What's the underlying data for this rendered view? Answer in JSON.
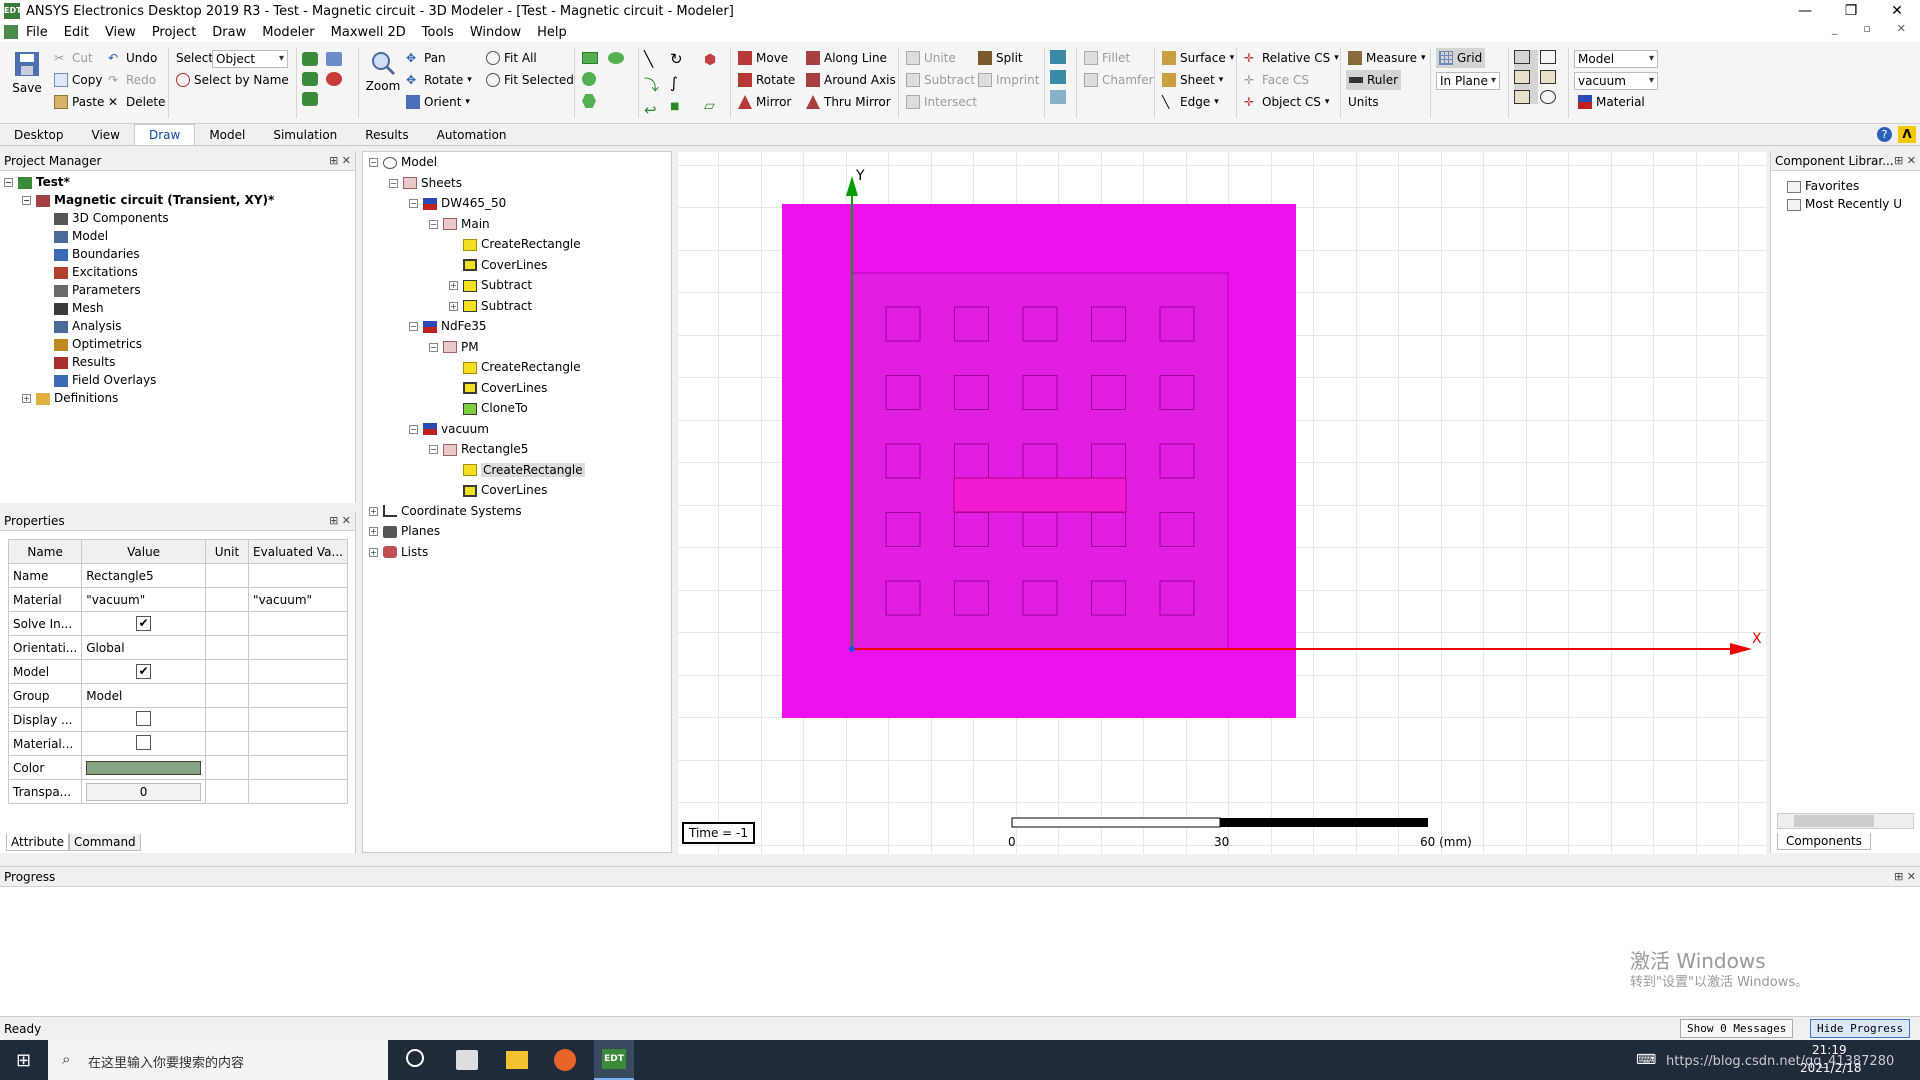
{
  "window": {
    "title": "ANSYS Electronics Desktop 2019 R3 - Test - Magnetic circuit - 3D Modeler - [Test - Magnetic circuit - Modeler]",
    "app_icon": "EDT"
  },
  "menu": [
    "File",
    "Edit",
    "View",
    "Project",
    "Draw",
    "Modeler",
    "Maxwell 2D",
    "Tools",
    "Window",
    "Help"
  ],
  "ribbon": {
    "save": "Save",
    "cut": "Cut",
    "copy": "Copy",
    "paste": "Paste",
    "undo": "Undo",
    "redo": "Redo",
    "delete": "Delete",
    "select_label": "Select:",
    "select_value": "Object",
    "select_by_name": "Select by Name",
    "zoom": "Zoom",
    "pan": "Pan",
    "rotate": "Rotate",
    "orient": "Orient",
    "fit_all": "Fit All",
    "fit_selected": "Fit Selected",
    "move": "Move",
    "rotate2": "Rotate",
    "mirror": "Mirror",
    "along_line": "Along Line",
    "around_axis": "Around Axis",
    "thru_mirror": "Thru Mirror",
    "unite": "Unite",
    "subtract": "Subtract",
    "intersect": "Intersect",
    "split": "Split",
    "imprint": "Imprint",
    "fillet": "Fillet",
    "chamfer": "Chamfer",
    "surface": "Surface",
    "sheet": "Sheet",
    "edge": "Edge",
    "relative_cs": "Relative CS",
    "face_cs": "Face CS",
    "object_cs": "Object CS",
    "measure": "Measure",
    "ruler": "Ruler",
    "units": "Units",
    "grid": "Grid",
    "in_plane": "In Plane",
    "model_dd": "Model",
    "material_dd": "vacuum",
    "material": "Material"
  },
  "tabs": [
    "Desktop",
    "View",
    "Draw",
    "Model",
    "Simulation",
    "Results",
    "Automation"
  ],
  "active_tab": "Draw",
  "project_manager": {
    "title": "Project Manager",
    "items": [
      {
        "label": "Test*",
        "level": 0,
        "exp": "-"
      },
      {
        "label": "Magnetic circuit (Transient, XY)*",
        "level": 1,
        "exp": "-"
      },
      {
        "label": "3D Components",
        "level": 2,
        "exp": ""
      },
      {
        "label": "Model",
        "level": 2,
        "exp": ""
      },
      {
        "label": "Boundaries",
        "level": 2,
        "exp": ""
      },
      {
        "label": "Excitations",
        "level": 2,
        "exp": ""
      },
      {
        "label": "Parameters",
        "level": 2,
        "exp": ""
      },
      {
        "label": "Mesh",
        "level": 2,
        "exp": ""
      },
      {
        "label": "Analysis",
        "level": 2,
        "exp": ""
      },
      {
        "label": "Optimetrics",
        "level": 2,
        "exp": ""
      },
      {
        "label": "Results",
        "level": 2,
        "exp": ""
      },
      {
        "label": "Field Overlays",
        "level": 2,
        "exp": ""
      },
      {
        "label": "Definitions",
        "level": 1,
        "exp": "+"
      }
    ]
  },
  "properties": {
    "title": "Properties",
    "headers": [
      "Name",
      "Value",
      "Unit",
      "Evaluated Va..."
    ],
    "rows": [
      {
        "name": "Name",
        "value": "Rectangle5",
        "unit": "",
        "eval": "",
        "type": "text"
      },
      {
        "name": "Material",
        "value": "\"vacuum\"",
        "unit": "",
        "eval": "\"vacuum\"",
        "type": "text"
      },
      {
        "name": "Solve In...",
        "value": "✔",
        "unit": "",
        "eval": "",
        "type": "check"
      },
      {
        "name": "Orientati...",
        "value": "Global",
        "unit": "",
        "eval": "",
        "type": "text"
      },
      {
        "name": "Model",
        "value": "✔",
        "unit": "",
        "eval": "",
        "type": "check"
      },
      {
        "name": "Group",
        "value": "Model",
        "unit": "",
        "eval": "",
        "type": "text"
      },
      {
        "name": "Display ...",
        "value": "",
        "unit": "",
        "eval": "",
        "type": "check"
      },
      {
        "name": "Material...",
        "value": "",
        "unit": "",
        "eval": "",
        "type": "check"
      },
      {
        "name": "Color",
        "value": "",
        "unit": "",
        "eval": "",
        "type": "color"
      },
      {
        "name": "Transpa...",
        "value": "0",
        "unit": "",
        "eval": "",
        "type": "field"
      }
    ],
    "color_swatch": "#84a484",
    "bottom_tabs": [
      "Attribute",
      "Command"
    ]
  },
  "model_tree": [
    {
      "label": "Model",
      "level": 0,
      "exp": "-",
      "icon": "model"
    },
    {
      "label": "Sheets",
      "level": 1,
      "exp": "-",
      "icon": "sheet"
    },
    {
      "label": "DW465_50",
      "level": 2,
      "exp": "-",
      "icon": "mat"
    },
    {
      "label": "Main",
      "level": 3,
      "exp": "-",
      "icon": "sheet"
    },
    {
      "label": "CreateRectangle",
      "level": 4,
      "exp": "",
      "icon": "rect"
    },
    {
      "label": "CoverLines",
      "level": 4,
      "exp": "",
      "icon": "cover"
    },
    {
      "label": "Subtract",
      "level": 4,
      "exp": "+",
      "icon": "op"
    },
    {
      "label": "Subtract",
      "level": 4,
      "exp": "+",
      "icon": "op"
    },
    {
      "label": "NdFe35",
      "level": 2,
      "exp": "-",
      "icon": "mat"
    },
    {
      "label": "PM",
      "level": 3,
      "exp": "-",
      "icon": "sheet"
    },
    {
      "label": "CreateRectangle",
      "level": 4,
      "exp": "",
      "icon": "rect"
    },
    {
      "label": "CoverLines",
      "level": 4,
      "exp": "",
      "icon": "cover"
    },
    {
      "label": "CloneTo",
      "level": 4,
      "exp": "",
      "icon": "clone"
    },
    {
      "label": "vacuum",
      "level": 2,
      "exp": "-",
      "icon": "mat"
    },
    {
      "label": "Rectangle5",
      "level": 3,
      "exp": "-",
      "icon": "sheet"
    },
    {
      "label": "CreateRectangle",
      "level": 4,
      "exp": "",
      "icon": "rect",
      "sel": true
    },
    {
      "label": "CoverLines",
      "level": 4,
      "exp": "",
      "icon": "cover"
    },
    {
      "label": "Coordinate Systems",
      "level": 0,
      "exp": "+",
      "icon": "cs"
    },
    {
      "label": "Planes",
      "level": 0,
      "exp": "+",
      "icon": "plane"
    },
    {
      "label": "Lists",
      "level": 0,
      "exp": "+",
      "icon": "list"
    }
  ],
  "viewport": {
    "axis_x": "X",
    "axis_y": "Y",
    "time": "Time = -1",
    "scale_labels": [
      "0",
      "30",
      "60 (mm)"
    ],
    "colors": {
      "outer": "#ee11ee",
      "inner": "#e21ee2",
      "bar": "#f21ad2",
      "axis_x": "#ee0000",
      "axis_y": "#00a000"
    }
  },
  "component_library": {
    "title": "Component Librar...",
    "items": [
      "Favorites",
      "Most Recently U"
    ],
    "tab": "Components"
  },
  "progress": {
    "title": "Progress",
    "watermark_1": "激活 Windows",
    "watermark_2": "转到\"设置\"以激活 Windows。"
  },
  "status": {
    "text": "Ready",
    "show_messages": "Show 0 Messages",
    "hide_progress": "Hide Progress"
  },
  "taskbar": {
    "search_placeholder": "在这里输入你要搜索的内容",
    "time": "21:19",
    "date": "2021/2/18",
    "url_watermark": "https://blog.csdn.net/qq_41387280"
  }
}
